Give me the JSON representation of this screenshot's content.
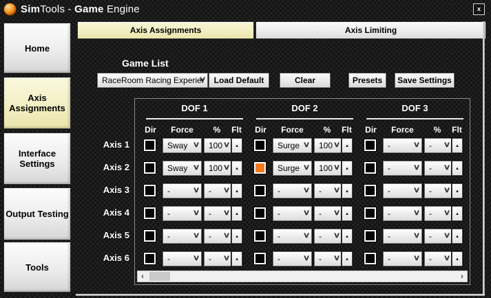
{
  "window": {
    "title": {
      "t1": "Sim",
      "t2": "Tools - ",
      "t3": "Game",
      "t4": " Engine"
    }
  },
  "icons": {
    "chevron_down": "∨",
    "spinner_up": "▴",
    "scroll_left": "‹",
    "scroll_right": "›",
    "close": "x"
  },
  "sidebar": {
    "items": [
      {
        "label": "Home",
        "active": false
      },
      {
        "label": "Axis Assignments",
        "active": true
      },
      {
        "label": "Interface Settings",
        "active": false
      },
      {
        "label": "Output Testing",
        "active": false
      },
      {
        "label": "Tools",
        "active": false
      }
    ]
  },
  "tabs": [
    {
      "label": "Axis Assignments",
      "active": true
    },
    {
      "label": "Axis Limiting",
      "active": false
    }
  ],
  "game_list": {
    "label": "Game List",
    "selected_game": "RaceRoom Racing Experier",
    "load_default": "Load Default",
    "clear": "Clear",
    "presets": "Presets",
    "save_settings": "Save Settings"
  },
  "table": {
    "dof_headers": [
      "DOF 1",
      "DOF 2",
      "DOF 3"
    ],
    "sub_headers": {
      "dir": "Dir",
      "force": "Force",
      "percent": "%",
      "flt": "Flt"
    },
    "rows": [
      {
        "label": "Axis 1",
        "cells": [
          {
            "dir_on": false,
            "force": "Sway",
            "percent": "100"
          },
          {
            "dir_on": false,
            "force": "Surge",
            "percent": "100"
          },
          {
            "dir_on": false,
            "force": "-",
            "percent": "-"
          }
        ]
      },
      {
        "label": "Axis 2",
        "cells": [
          {
            "dir_on": false,
            "force": "Sway",
            "percent": "100"
          },
          {
            "dir_on": true,
            "force": "Surge",
            "percent": "100"
          },
          {
            "dir_on": false,
            "force": "-",
            "percent": "-"
          }
        ]
      },
      {
        "label": "Axis 3",
        "cells": [
          {
            "dir_on": false,
            "force": "-",
            "percent": "-"
          },
          {
            "dir_on": false,
            "force": "-",
            "percent": "-"
          },
          {
            "dir_on": false,
            "force": "-",
            "percent": "-"
          }
        ]
      },
      {
        "label": "Axis 4",
        "cells": [
          {
            "dir_on": false,
            "force": "-",
            "percent": "-"
          },
          {
            "dir_on": false,
            "force": "-",
            "percent": "-"
          },
          {
            "dir_on": false,
            "force": "-",
            "percent": "-"
          }
        ]
      },
      {
        "label": "Axis 5",
        "cells": [
          {
            "dir_on": false,
            "force": "-",
            "percent": "-"
          },
          {
            "dir_on": false,
            "force": "-",
            "percent": "-"
          },
          {
            "dir_on": false,
            "force": "-",
            "percent": "-"
          }
        ]
      },
      {
        "label": "Axis 6",
        "cells": [
          {
            "dir_on": false,
            "force": "-",
            "percent": "-"
          },
          {
            "dir_on": false,
            "force": "-",
            "percent": "-"
          },
          {
            "dir_on": false,
            "force": "-",
            "percent": "-"
          }
        ]
      }
    ]
  },
  "colors": {
    "dir_active_orange": "#F47B20",
    "active_highlight_yellow": "#F2EEC2",
    "checkbox_black": "#050505",
    "window_bg_dark": "#181818"
  }
}
